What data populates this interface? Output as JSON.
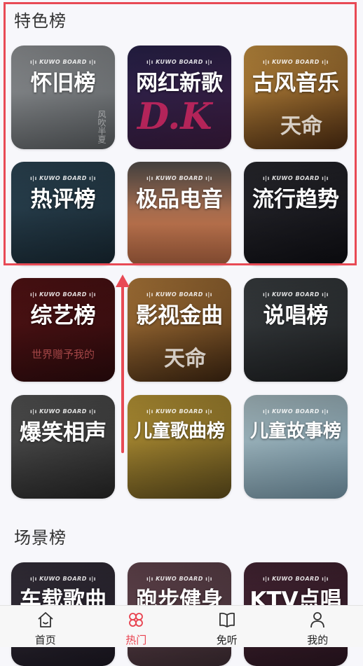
{
  "sections": {
    "featured_title": "特色榜",
    "scene_title": "场景榜"
  },
  "brand": "KUWO BOARD",
  "cards": [
    {
      "title": "怀旧榜",
      "deco": "风吹半夏",
      "bg": [
        "#8c8f92",
        "#4f5356"
      ]
    },
    {
      "title": "网红新歌",
      "deco": "D.K",
      "bg": [
        "#2b2450",
        "#3a1a3c"
      ]
    },
    {
      "title": "古风音乐",
      "deco": "天命",
      "bg": [
        "#c58a3a",
        "#4a2a10"
      ]
    },
    {
      "title": "热评榜",
      "deco": "",
      "bg": [
        "#2f4a5a",
        "#16252f"
      ]
    },
    {
      "title": "极品电音",
      "deco": "",
      "bg": [
        "#c77a52",
        "#5b3e32"
      ]
    },
    {
      "title": "流行趋势",
      "deco": "",
      "bg": [
        "#2b2b31",
        "#0d0d12"
      ]
    },
    {
      "title": "综艺榜",
      "deco": "世界赠予我的",
      "bg": [
        "#5a1416",
        "#2a0a0c"
      ]
    },
    {
      "title": "影视金曲",
      "deco": "天命",
      "bg": [
        "#b57a3a",
        "#3b2410"
      ]
    },
    {
      "title": "说唱榜",
      "deco": "",
      "bg": [
        "#3e4346",
        "#1a1c1e"
      ]
    },
    {
      "title": "爆笑相声",
      "deco": "",
      "bg": [
        "#4b4b4b",
        "#242424"
      ]
    },
    {
      "title": "儿童歌曲榜",
      "deco": "",
      "bg": [
        "#b9952f",
        "#5b4a1b"
      ]
    },
    {
      "title": "儿童故事榜",
      "deco": "",
      "bg": [
        "#a7c0c6",
        "#6f8fa0"
      ]
    },
    {
      "title": "车载歌曲",
      "deco": "",
      "bg": [
        "#3a3440",
        "#1a1620"
      ]
    },
    {
      "title": "跑步健身",
      "deco": "",
      "bg": [
        "#6c4b55",
        "#3a2a30"
      ]
    },
    {
      "title": "KTV点唱",
      "deco": "",
      "bg": [
        "#4b2838",
        "#2a1520"
      ]
    }
  ],
  "tabs": [
    {
      "label": "首页",
      "icon": "home-icon",
      "active": false
    },
    {
      "label": "热门",
      "icon": "clover-icon",
      "active": true
    },
    {
      "label": "免听",
      "icon": "book-icon",
      "active": false
    },
    {
      "label": "我的",
      "icon": "user-icon",
      "active": false
    }
  ],
  "colors": {
    "accent": "#e8424f",
    "highlight_border": "#e84a55"
  }
}
